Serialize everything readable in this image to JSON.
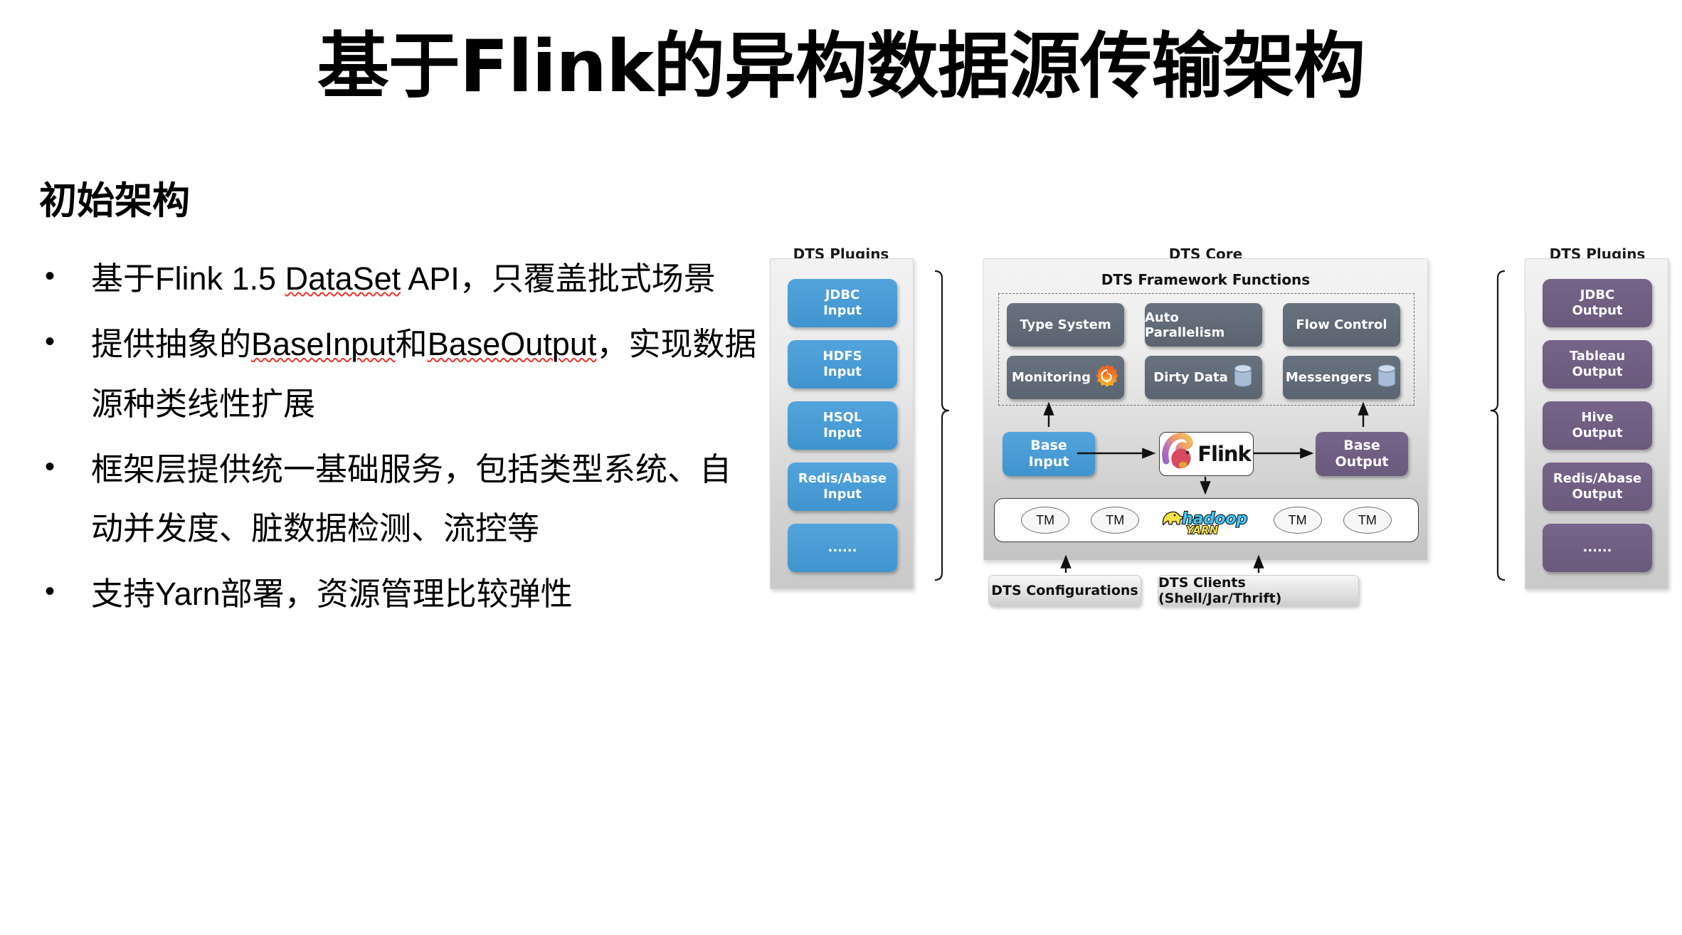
{
  "slide": {
    "title": "基于Flink的异构数据源传输架构",
    "subheading": "初始架构",
    "bullets": [
      {
        "pre": "基于Flink 1.5 ",
        "squiggle": "DataSet",
        "post": " API，只覆盖批式场景"
      },
      {
        "pre": "提供抽象的",
        "squiggle": "BaseInput",
        "mid": "和",
        "squiggle2": "BaseOutput",
        "post": "，实现数据源种类线性扩展"
      },
      {
        "pre": "框架层提供统一基础服务，包括类型系统、自动并发度、脏数据检测、流控等",
        "squiggle": "",
        "post": ""
      },
      {
        "pre": "支持Yarn部署，资源管理比较弹性",
        "squiggle": "",
        "post": ""
      }
    ]
  },
  "diagram": {
    "left_panel": {
      "title": "DTS Plugins",
      "items": [
        {
          "line1": "JDBC",
          "line2": "Input"
        },
        {
          "line1": "HDFS",
          "line2": "Input"
        },
        {
          "line1": "HSQL",
          "line2": "Input"
        },
        {
          "line1": "Redis/Abase",
          "line2": "Input"
        },
        {
          "line1": "......",
          "line2": ""
        }
      ]
    },
    "core": {
      "title": "DTS Core",
      "framework_title": "DTS Framework Functions",
      "functions": [
        {
          "label": "Type System",
          "icon": ""
        },
        {
          "label": "Auto Parallelism",
          "icon": ""
        },
        {
          "label": "Flow Control",
          "icon": ""
        },
        {
          "label": "Monitoring",
          "icon": "grafana-icon"
        },
        {
          "label": "Dirty Data",
          "icon": "database-icon"
        },
        {
          "label": "Messengers",
          "icon": "database-icon"
        }
      ],
      "base_input": {
        "line1": "Base",
        "line2": "Input"
      },
      "base_output": {
        "line1": "Base",
        "line2": "Output"
      },
      "engine": {
        "label": "Flink",
        "icon": "flink-squirrel-icon"
      },
      "task_managers": [
        "TM",
        "TM",
        "TM",
        "TM"
      ],
      "cluster_icon": "hadoop-yarn-icon",
      "cluster_icon_text": {
        "hadoop": "hadoop",
        "yarn": "YARN"
      }
    },
    "bottom": {
      "configurations": "DTS Configurations",
      "clients": "DTS Clients (Shell/Jar/Thrift)"
    },
    "right_panel": {
      "title": "DTS Plugins",
      "items": [
        {
          "line1": "JDBC",
          "line2": "Output"
        },
        {
          "line1": "Tableau",
          "line2": "Output"
        },
        {
          "line1": "Hive",
          "line2": "Output"
        },
        {
          "line1": "Redis/Abase",
          "line2": "Output"
        },
        {
          "line1": "......",
          "line2": ""
        }
      ]
    },
    "colors": {
      "input_blue": "#4a9fdb",
      "output_purple": "#6f5d7e",
      "function_gray": "#5e6875",
      "squiggle_red": "#e8342a"
    }
  }
}
